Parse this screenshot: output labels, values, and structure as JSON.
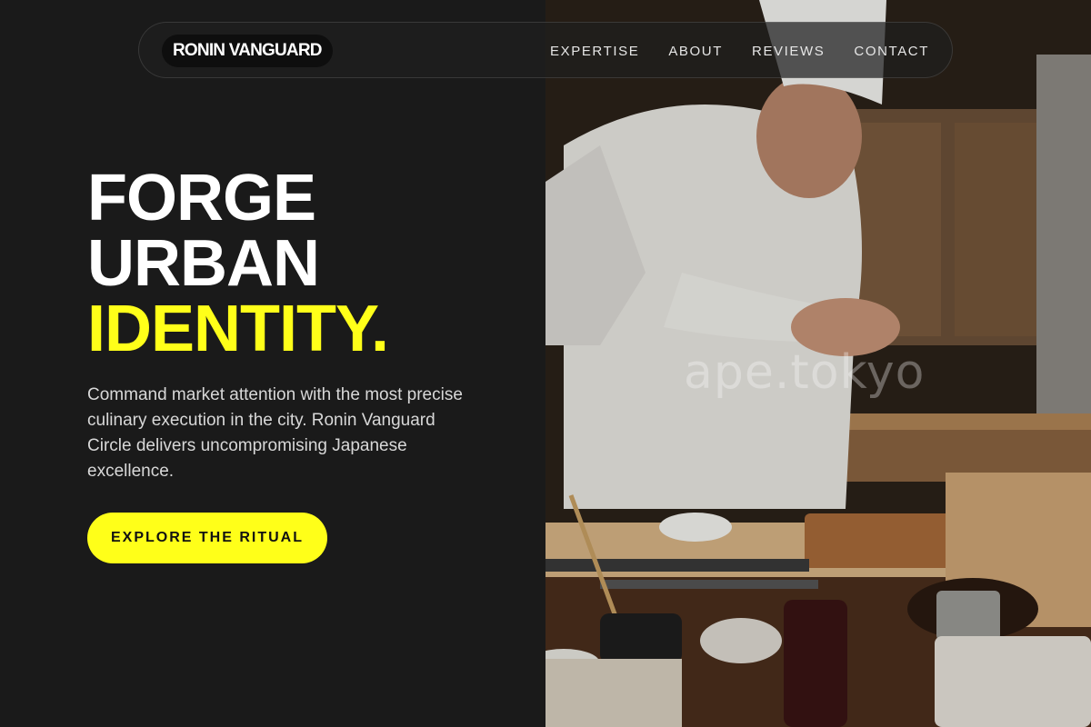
{
  "nav": {
    "brand": "RONIN VANGUARD",
    "links": [
      "EXPERTISE",
      "ABOUT",
      "REVIEWS",
      "CONTACT"
    ]
  },
  "hero": {
    "headline_line1": "FORGE",
    "headline_line2": "URBAN",
    "headline_line3": "IDENTITY.",
    "description": "Command market attention with the most precise culinary execution in the city. Ronin Vanguard Circle delivers uncompromising Japanese excellence.",
    "cta_label": "EXPLORE THE RITUAL"
  },
  "photo": {
    "watermark": "ape.tokyo"
  },
  "colors": {
    "background": "#1a1a1a",
    "accent": "#ffff19",
    "text": "#ffffff",
    "muted_text": "#d8d8d8"
  }
}
